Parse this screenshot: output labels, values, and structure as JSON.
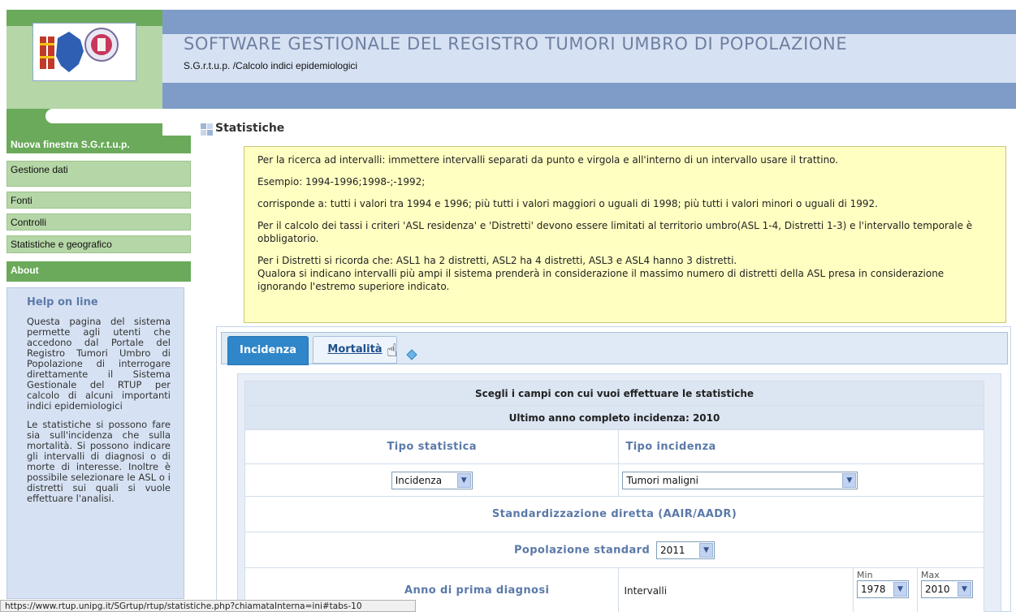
{
  "header": {
    "title": "SOFTWARE GESTIONALE DEL REGISTRO TUMORI UMBRO DI POPOLAZIONE",
    "subtitle": "S.G.r.t.u.p. /Calcolo indici epidemiologici",
    "logo_icon": "umbria-region-logo-icon"
  },
  "sidebar": {
    "items": [
      {
        "label": "Nuova finestra S.G.r.t.u.p."
      },
      {
        "label": "Gestione dati"
      },
      {
        "label": "Fonti"
      },
      {
        "label": "Controlli"
      },
      {
        "label": "Statistiche e geografico"
      },
      {
        "label": "About"
      }
    ],
    "help": {
      "title": "Help on line",
      "paragraphs": [
        "Questa pagina del sistema permette agli utenti che accedono dal Portale del Registro Tumori Umbro di Popolazione di interrogare direttamente il Sistema Gestionale del RTUP per calcolo di alcuni importanti indici epidemiologici",
        "Le statistiche si possono fare sia sull'incidenza che sulla mortalità. Si possono indicare gli intervalli di diagnosi o di morte di interesse. Inoltre è possibile selezionare le ASL o i distretti sui quali si vuole effettuare l'analisi."
      ]
    }
  },
  "main": {
    "section_title": "Statistiche",
    "info": {
      "p1": "Per la ricerca ad intervalli: immettere intervalli separati da punto e virgola e all'interno di un intervallo usare il trattino.",
      "p2": "Esempio: 1994-1996;1998-;-1992;",
      "p3": "corrisponde a: tutti i valori tra 1994 e 1996; più tutti i valori maggiori o uguali di 1998; più tutti i valori minori o uguali di 1992.",
      "p4": "Per il calcolo dei tassi i criteri 'ASL residenza' e 'Distretti' devono essere limitati al territorio umbro(ASL 1-4, Distretti 1-3) e l'intervallo temporale è obbligatorio.",
      "p5a": "Per i Distretti si ricorda che: ASL1 ha 2 distretti, ASL2 ha 4 distretti, ASL3 e ASL4 hanno 3 distretti.",
      "p5b": "Qualora si indicano intervalli più ampi il sistema prenderà in considerazione il massimo numero di distretti della ASL presa in considerazione ignorando l'estremo superiore indicato."
    },
    "tabs": [
      {
        "label": "Incidenza",
        "active": true
      },
      {
        "label": "Mortalità",
        "active": false
      }
    ],
    "form": {
      "header": "Scegli i campi con cui vuoi effettuare le statistiche",
      "subheader": "Ultimo anno completo incidenza: 2010",
      "tipo_statistica_label": "Tipo statistica",
      "tipo_incidenza_label": "Tipo incidenza",
      "tipo_statistica_value": "Incidenza",
      "tipo_incidenza_value": "Tumori maligni",
      "standardizzazione_label": "Standardizzazione diretta (AAIR/AADR)",
      "popolazione_label": "Popolazione standard",
      "popolazione_value": "2011",
      "anno_label": "Anno di prima diagnosi",
      "intervalli_label": "Intervalli",
      "min_label": "Min",
      "max_label": "Max",
      "min_value": "1978",
      "max_value": "2010"
    }
  },
  "status_bar": {
    "url": "https://www.rtup.unipg.it/SGrtup/rtup/statistiche.php?chiamataInterna=ini#tabs-10"
  },
  "colors": {
    "header_blue": "#7f9cc8",
    "sidebar_green": "#6aaa5a",
    "tab_active": "#2f86c9",
    "info_bg": "#ffffc2"
  }
}
